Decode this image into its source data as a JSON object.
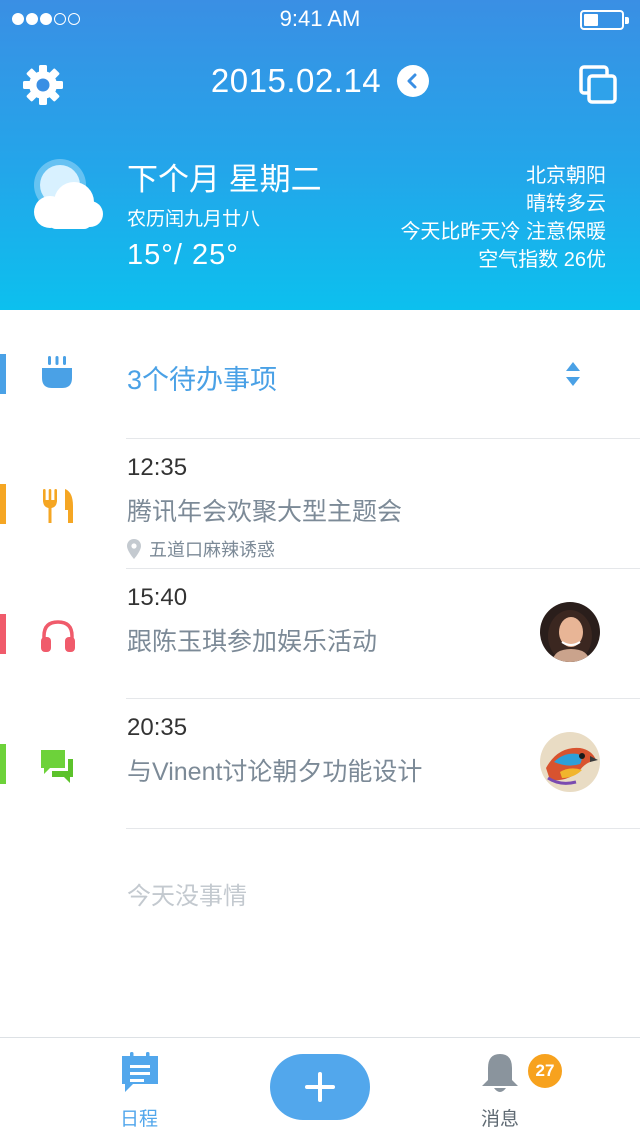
{
  "status_bar": {
    "time": "9:41 AM"
  },
  "header": {
    "date": "2015.02.14"
  },
  "weather": {
    "title": "下个月 星期二",
    "lunar": "农历闰九月廿八",
    "temp": "15°/ 25°",
    "location": "北京朝阳",
    "condition": "晴转多云",
    "advice": "今天比昨天冷 注意保暖",
    "aqi": "空气指数 26优"
  },
  "todo": {
    "label": "3个待办事项",
    "color": "#4aa1e6"
  },
  "events": [
    {
      "time": "12:35",
      "title": "腾讯年会欢聚大型主题会",
      "location": "五道口麻辣诱惑",
      "icon": "fork-knife-icon",
      "color": "#f5a623"
    },
    {
      "time": "15:40",
      "title": "跟陈玉琪参加娱乐活动",
      "icon": "headphones-icon",
      "color": "#f05b6b"
    },
    {
      "time": "20:35",
      "title": "与Vinent讨论朝夕功能设计",
      "icon": "chat-bubble-icon",
      "color": "#6dd23a"
    }
  ],
  "empty_text": "今天没事情",
  "tabbar": {
    "schedule_label": "日程",
    "messages_label": "消息",
    "badge_count": "27",
    "accent": "#52a7ec",
    "badge_color": "#f7a21e"
  }
}
